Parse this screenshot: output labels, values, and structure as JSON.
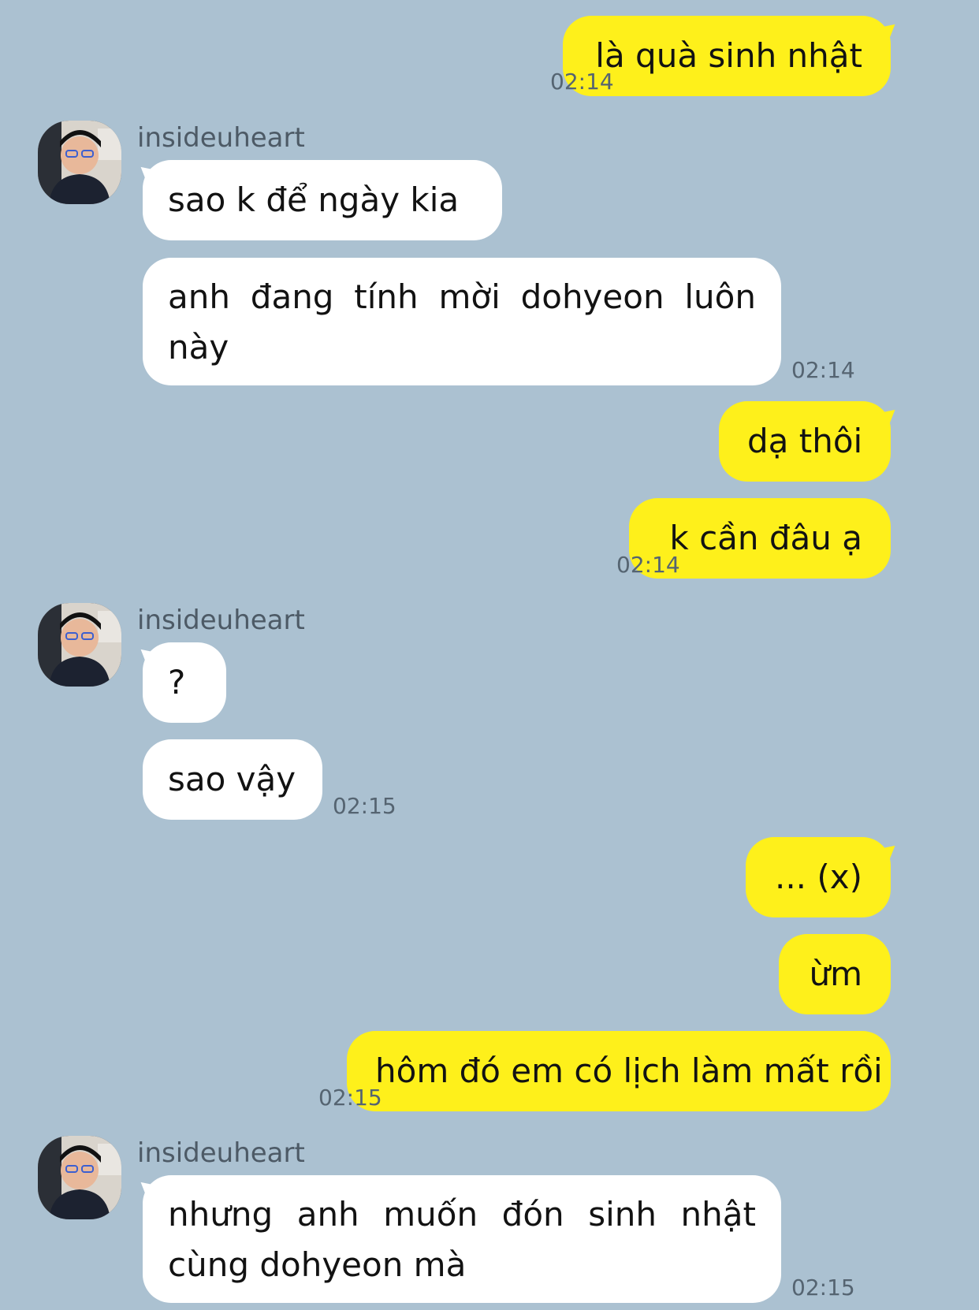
{
  "colors": {
    "background": "#abc1d1",
    "outgoing_bubble": "#fef01b",
    "incoming_bubble": "#ffffff",
    "timestamp": "#556471"
  },
  "contact": {
    "name": "insideuheart",
    "avatar_icon": "profile-photo-icon"
  },
  "messages": [
    {
      "dir": "out",
      "text": "là quà sinh nhật",
      "time": "02:14"
    },
    {
      "dir": "in",
      "text": "sao k để ngày kia",
      "time": ""
    },
    {
      "dir": "in",
      "text": "anh đang tính mời dohyeon luôn này",
      "time": "02:14"
    },
    {
      "dir": "out",
      "text": "dạ thôi",
      "time": ""
    },
    {
      "dir": "out",
      "text": "k cần đâu ạ",
      "time": "02:14"
    },
    {
      "dir": "in",
      "text": "?",
      "time": ""
    },
    {
      "dir": "in",
      "text": "sao vậy",
      "time": "02:15"
    },
    {
      "dir": "out",
      "text": "... (x)",
      "time": ""
    },
    {
      "dir": "out",
      "text": "ừm",
      "time": ""
    },
    {
      "dir": "out",
      "text": "hôm đó em có lịch làm mất rồi",
      "time": "02:15"
    },
    {
      "dir": "in",
      "text": "nhưng anh muốn đón sinh nhật cùng dohyeon mà",
      "time": "02:15"
    }
  ]
}
